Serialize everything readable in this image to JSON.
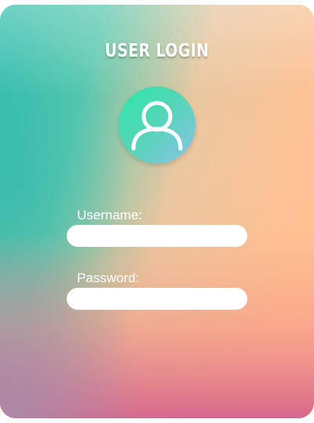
{
  "login": {
    "title": "USER LOGIN",
    "avatar_icon": "user-icon",
    "username_label": "Username:",
    "username_value": "",
    "password_label": "Password:",
    "password_value": ""
  },
  "colors": {
    "teal": "#35bfae",
    "peach": "#ffc192",
    "pink": "#d8658d",
    "avatar_green": "#2ee6a6",
    "avatar_blue": "#8cc4e6"
  }
}
